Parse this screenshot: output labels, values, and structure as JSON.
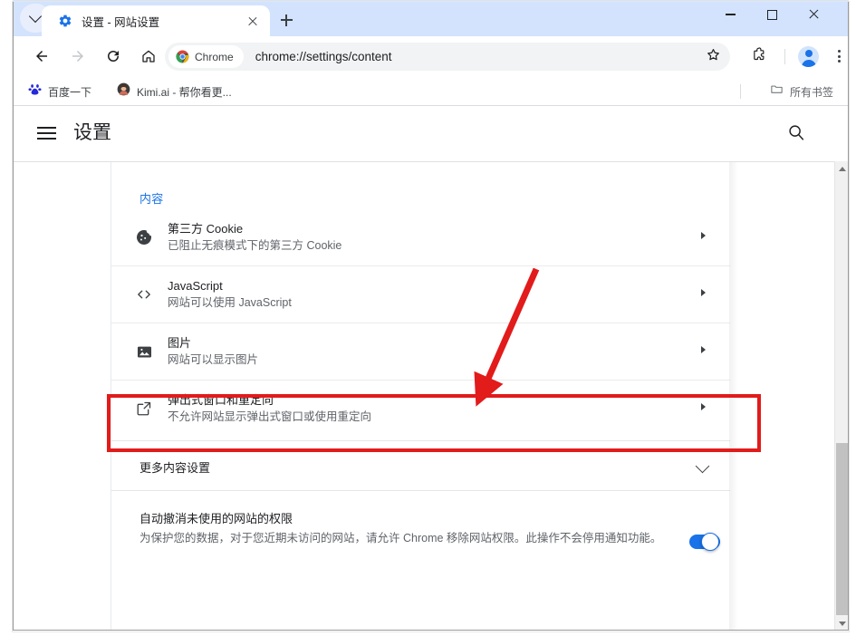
{
  "browser": {
    "tab": {
      "title": "设置 - 网站设置",
      "favicon": "settings-gear-icon",
      "close_label": "×"
    },
    "new_tab_label": "+",
    "window_controls": {
      "minimize": "—",
      "maximize": "□",
      "close": "✕"
    },
    "toolbar": {
      "back": "←",
      "forward": "→",
      "reload": "⟳",
      "home": "⌂",
      "chrome_chip": "Chrome",
      "url": "chrome://settings/content",
      "star": "bookmark-star-icon",
      "extensions": "extensions-puzzle-icon",
      "profile": "profile-avatar",
      "menu": "three-dot-menu"
    },
    "bookmarks": [
      {
        "label": "百度一下",
        "icon": "baidu-icon"
      },
      {
        "label": "Kimi.ai - 帮你看更...",
        "icon": "kimi-avatar-icon"
      }
    ],
    "bookmarks_all": {
      "label": "所有书签",
      "icon": "folder-icon"
    }
  },
  "settings_header": {
    "menu_icon": "hamburger-icon",
    "title": "设置",
    "search_icon": "search-icon"
  },
  "content": {
    "section_title": "内容",
    "rows": [
      {
        "icon": "cookie-icon",
        "title": "第三方 Cookie",
        "subtitle": "已阻止无痕模式下的第三方 Cookie"
      },
      {
        "icon": "code-brackets-icon",
        "title": "JavaScript",
        "subtitle": "网站可以使用 JavaScript"
      },
      {
        "icon": "image-icon",
        "title": "图片",
        "subtitle": "网站可以显示图片"
      },
      {
        "icon": "popup-external-link-icon",
        "title": "弹出式窗口和重定向",
        "subtitle": "不允许网站显示弹出式窗口或使用重定向"
      }
    ],
    "more_settings": {
      "label": "更多内容设置",
      "expand_icon": "chevron-down-icon"
    },
    "auto_revoke": {
      "title": "自动撤消未使用的网站的权限",
      "description": "为保护您的数据，对于您近期未访问的网站，请允许 Chrome 移除网站权限。此操作不会停用通知功能。",
      "toggle_state": "on"
    }
  },
  "annotation": {
    "highlight_target": "弹出式窗口和重定向",
    "arrow_color": "#e21b1b",
    "box_color": "#e21b1b"
  },
  "colors": {
    "accent": "#1a73e8",
    "tabstrip": "#d3e3fd",
    "annotation_red": "#e21b1b"
  }
}
